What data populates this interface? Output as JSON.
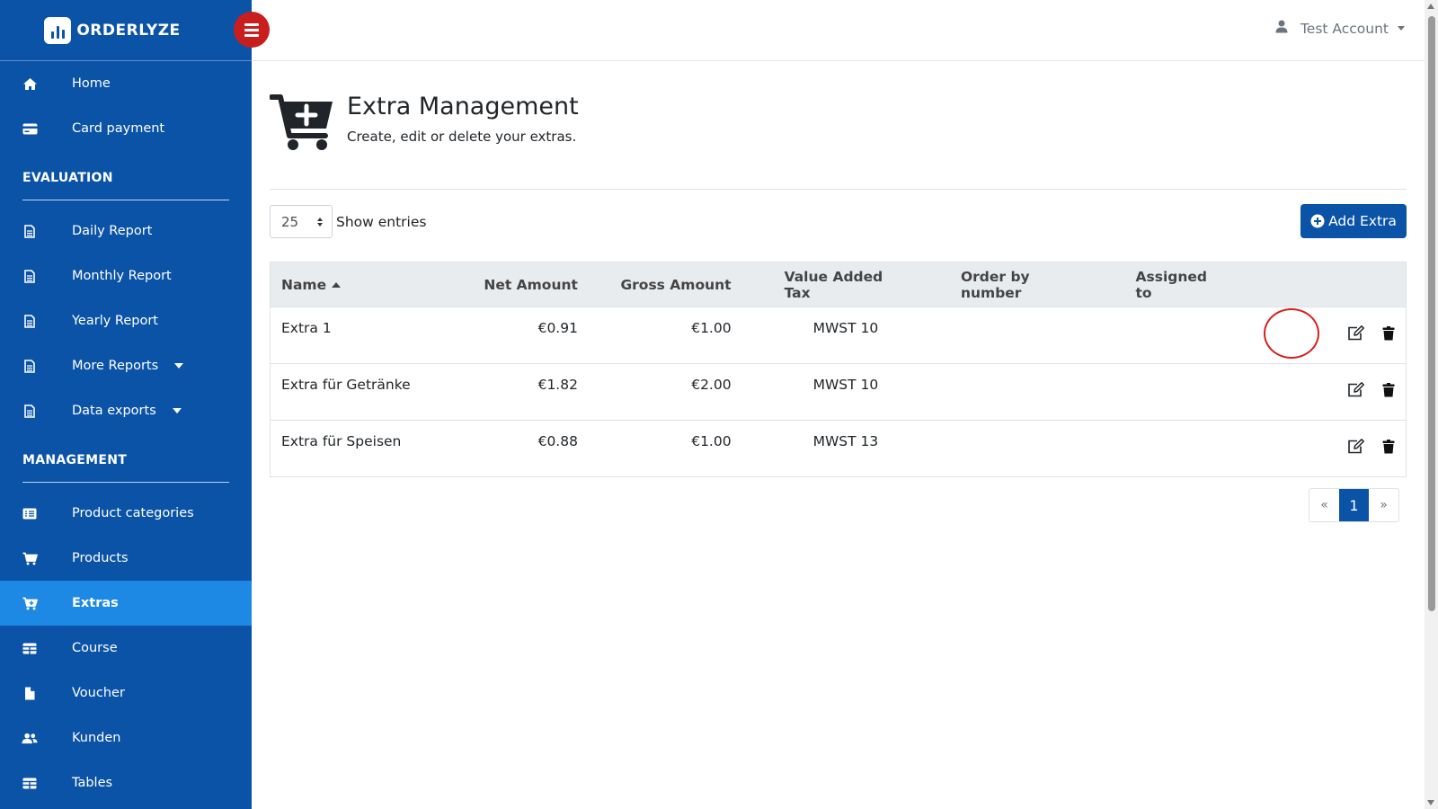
{
  "app": {
    "brand": "ORDERLYZE"
  },
  "account": {
    "label": "Test Account"
  },
  "sidebar": {
    "top_items": [
      {
        "label": "Home",
        "icon": "home-icon"
      },
      {
        "label": "Card payment",
        "icon": "credit-card-icon"
      }
    ],
    "evaluation": {
      "heading": "EVALUATION",
      "items": [
        {
          "label": "Daily Report",
          "icon": "document-icon"
        },
        {
          "label": "Monthly Report",
          "icon": "document-icon"
        },
        {
          "label": "Yearly Report",
          "icon": "document-icon"
        },
        {
          "label": "More Reports",
          "icon": "document-icon",
          "dropdown": true
        },
        {
          "label": "Data exports",
          "icon": "document-icon",
          "dropdown": true
        }
      ]
    },
    "management": {
      "heading": "MANAGEMENT",
      "items": [
        {
          "label": "Product categories",
          "icon": "list-icon"
        },
        {
          "label": "Products",
          "icon": "cart-icon"
        },
        {
          "label": "Extras",
          "icon": "cart-plus-icon",
          "active": true
        },
        {
          "label": "Course",
          "icon": "table-icon"
        },
        {
          "label": "Voucher",
          "icon": "file-icon"
        },
        {
          "label": "Kunden",
          "icon": "users-icon"
        },
        {
          "label": "Tables",
          "icon": "table-icon"
        }
      ]
    }
  },
  "page": {
    "title": "Extra Management",
    "subtitle": "Create, edit or delete your extras.",
    "icon": "cart-plus-icon"
  },
  "controls": {
    "page_size": "25",
    "show_entries_label": "Show entries",
    "add_button_label": "Add Extra"
  },
  "table": {
    "columns": [
      "Name",
      "Net Amount",
      "Gross Amount",
      "Value Added Tax",
      "Order by number",
      "Assigned to"
    ],
    "rows": [
      {
        "name": "Extra 1",
        "net": "€0.91",
        "gross": "€1.00",
        "vat": "MWST 10",
        "order": "",
        "assigned": ""
      },
      {
        "name": "Extra für Getränke",
        "net": "€1.82",
        "gross": "€2.00",
        "vat": "MWST 10",
        "order": "",
        "assigned": ""
      },
      {
        "name": "Extra für Speisen",
        "net": "€0.88",
        "gross": "€1.00",
        "vat": "MWST 13",
        "order": "",
        "assigned": ""
      }
    ]
  },
  "pagination": {
    "prev": "«",
    "current": "1",
    "next": "»"
  },
  "colors": {
    "sidebar": "#0b53a6",
    "active": "#1e88e5",
    "toggle": "#c81e1e",
    "highlight": "#d61f1f"
  }
}
